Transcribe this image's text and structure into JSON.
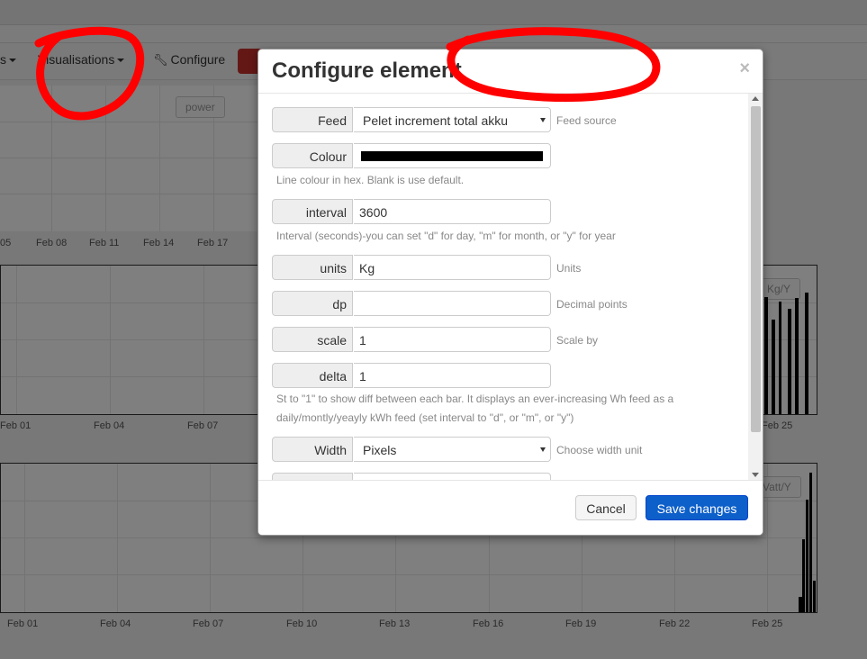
{
  "app": {
    "menu": {
      "partial_label": "s",
      "visualisations_label": "Visualisations",
      "configure_label": "Configure"
    },
    "charts": [
      {
        "legend_chips": [
          "power",
          ""
        ],
        "x_ticks": [
          "05",
          "Feb 08",
          "Feb 11",
          "Feb 14",
          "Feb 17"
        ]
      },
      {
        "legend_chip": "Kg/Y",
        "x_ticks": [
          "Feb 01",
          "Feb 04",
          "Feb 07",
          "Feb 25"
        ]
      },
      {
        "legend_chip": "Vatt/Y",
        "x_ticks": [
          "Feb 01",
          "Feb 04",
          "Feb 07",
          "Feb 10",
          "Feb 13",
          "Feb 16",
          "Feb 19",
          "Feb 22",
          "Feb 25"
        ]
      }
    ]
  },
  "modal": {
    "title": "Configure element",
    "close_glyph": "×",
    "fields": {
      "feed": {
        "label": "Feed",
        "value": "Pelet increment total akku",
        "help": "Feed source"
      },
      "colour": {
        "label": "Colour",
        "value_color": "#000000",
        "help": "Line colour in hex. Blank is use default."
      },
      "interval": {
        "label": "interval",
        "value": "3600",
        "help": "Interval (seconds)-you can set \"d\" for day, \"m\" for month, or \"y\" for year"
      },
      "units": {
        "label": "units",
        "value": "Kg",
        "help": "Units"
      },
      "dp": {
        "label": "dp",
        "value": "",
        "help": "Decimal points"
      },
      "scale": {
        "label": "scale",
        "value": "1",
        "help": "Scale by"
      },
      "delta": {
        "label": "delta",
        "value": "1",
        "help": "St to \"1\" to show diff between each bar. It displays an ever-increasing Wh feed as a daily/montly/yeayly kWh feed (set interval to \"d\", or \"m\", or \"y\")"
      },
      "width": {
        "label": "Width",
        "value": "Pixels",
        "help": "Choose width unit"
      }
    },
    "footer": {
      "cancel_label": "Cancel",
      "save_label": "Save changes"
    }
  },
  "colors": {
    "annotation": "#ff0000",
    "save_button": "#0d5fc9",
    "danger_button": "#c9302c"
  }
}
